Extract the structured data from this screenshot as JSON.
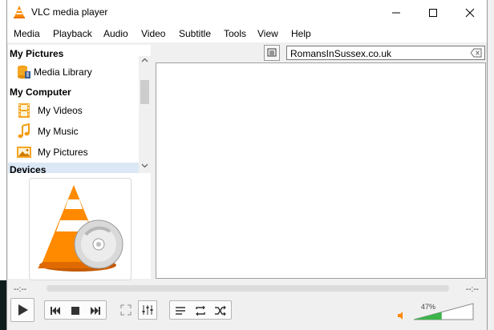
{
  "window": {
    "title": "VLC media player",
    "controls": [
      "minimize",
      "maximize",
      "close"
    ]
  },
  "menu": [
    "Media",
    "Playback",
    "Audio",
    "Video",
    "Subtitle",
    "Tools",
    "View",
    "Help"
  ],
  "sidebar": {
    "sections": [
      {
        "heading": "My Pictures",
        "items": [
          {
            "label": "Media Library",
            "icon": "media-library-icon"
          }
        ]
      },
      {
        "heading": "My Computer",
        "items": [
          {
            "label": "My Videos",
            "icon": "film-icon"
          },
          {
            "label": "My Music",
            "icon": "music-note-icon"
          },
          {
            "label": "My Pictures",
            "icon": "picture-icon"
          }
        ]
      },
      {
        "heading": "Devices",
        "items": []
      }
    ]
  },
  "search": {
    "value": "RomansInSussex.co.uk"
  },
  "player": {
    "time_elapsed": "--:--",
    "time_remaining": "--:--",
    "volume_label": "47%",
    "volume_level": 0.47
  },
  "colors": {
    "accent": "#ff8800",
    "volume_fill": "#3bb54a"
  }
}
